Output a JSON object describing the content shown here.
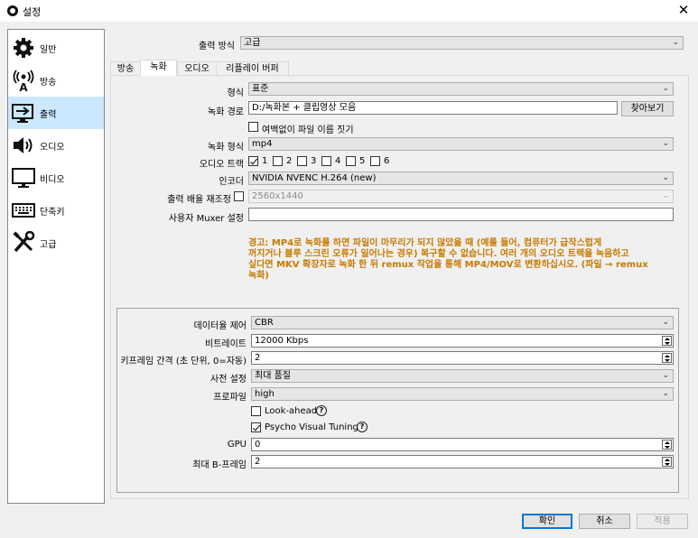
{
  "window": {
    "title": "설정",
    "close_glyph": "✕"
  },
  "sidebar": {
    "items": [
      {
        "label": "일반",
        "icon": "gear-icon"
      },
      {
        "label": "방송",
        "icon": "broadcast-icon"
      },
      {
        "label": "출력",
        "icon": "output-icon",
        "active": true
      },
      {
        "label": "오디오",
        "icon": "speaker-icon"
      },
      {
        "label": "비디오",
        "icon": "monitor-icon"
      },
      {
        "label": "단축키",
        "icon": "keyboard-icon"
      },
      {
        "label": "고급",
        "icon": "tools-icon"
      }
    ]
  },
  "output_mode": {
    "label": "출력 방식",
    "value": "고급"
  },
  "tabs": [
    {
      "label": "방송"
    },
    {
      "label": "녹화",
      "active": true
    },
    {
      "label": "오디오"
    },
    {
      "label": "리플레이 버퍼"
    }
  ],
  "recording": {
    "format_label": "형식",
    "format_value": "표준",
    "path_label": "녹화 경로",
    "path_value": "D:/녹화본 + 클립영상 모음",
    "browse_label": "찾아보기",
    "no_space_label": "여백없이 파일 이름 짓기",
    "no_space_checked": false,
    "rec_format_label": "녹화 형식",
    "rec_format_value": "mp4",
    "audio_track_label": "오디오 트랙",
    "audio_tracks": [
      {
        "label": "1",
        "checked": true
      },
      {
        "label": "2",
        "checked": false
      },
      {
        "label": "3",
        "checked": false
      },
      {
        "label": "4",
        "checked": false
      },
      {
        "label": "5",
        "checked": false
      },
      {
        "label": "6",
        "checked": false
      }
    ],
    "encoder_label": "인코더",
    "encoder_value": "NVIDIA NVENC H.264 (new)",
    "rescale_label": "출력 배율 재조정",
    "rescale_checked": false,
    "rescale_value": "2560x1440",
    "muxer_label": "사용자 Muxer 설정",
    "muxer_value": "",
    "warning_lines": [
      "경고: MP4로 녹화를 하면 파일이 마무리가 되지 않았을 때 (예를 들어, 컴퓨터가 급작스럽게",
      "꺼지거나 블루 스크린 오류가 일어나는 경우) 복구할 수 없습니다. 여러 개의 오디오 트랙을 녹음하고",
      "싶다면 MKV 확장자로 녹화 한 뒤 remux 작업을 통해 MP4/MOV로 변환하십시오. (파일 → remux",
      "녹화)"
    ]
  },
  "encoder_settings": {
    "rate_control_label": "데이터율 제어",
    "rate_control_value": "CBR",
    "bitrate_label": "비트레이트",
    "bitrate_value": "12000 Kbps",
    "keyframe_label": "키프레임 간격 (초 단위, 0=자동)",
    "keyframe_value": "2",
    "preset_label": "사전 설정",
    "preset_value": "최대 품질",
    "profile_label": "프로파일",
    "profile_value": "high",
    "lookahead_label": "Look-ahead",
    "lookahead_checked": false,
    "psycho_label": "Psycho Visual Tuning",
    "psycho_checked": true,
    "help_glyph": "?",
    "gpu_label": "GPU",
    "gpu_value": "0",
    "bframes_label": "최대 B-프레임",
    "bframes_value": "2"
  },
  "buttons": {
    "ok": "확인",
    "cancel": "취소",
    "apply": "적용"
  },
  "colors": {
    "selection": "#cce8ff",
    "warning": "#c87a00",
    "default_button": "#0078d7"
  }
}
